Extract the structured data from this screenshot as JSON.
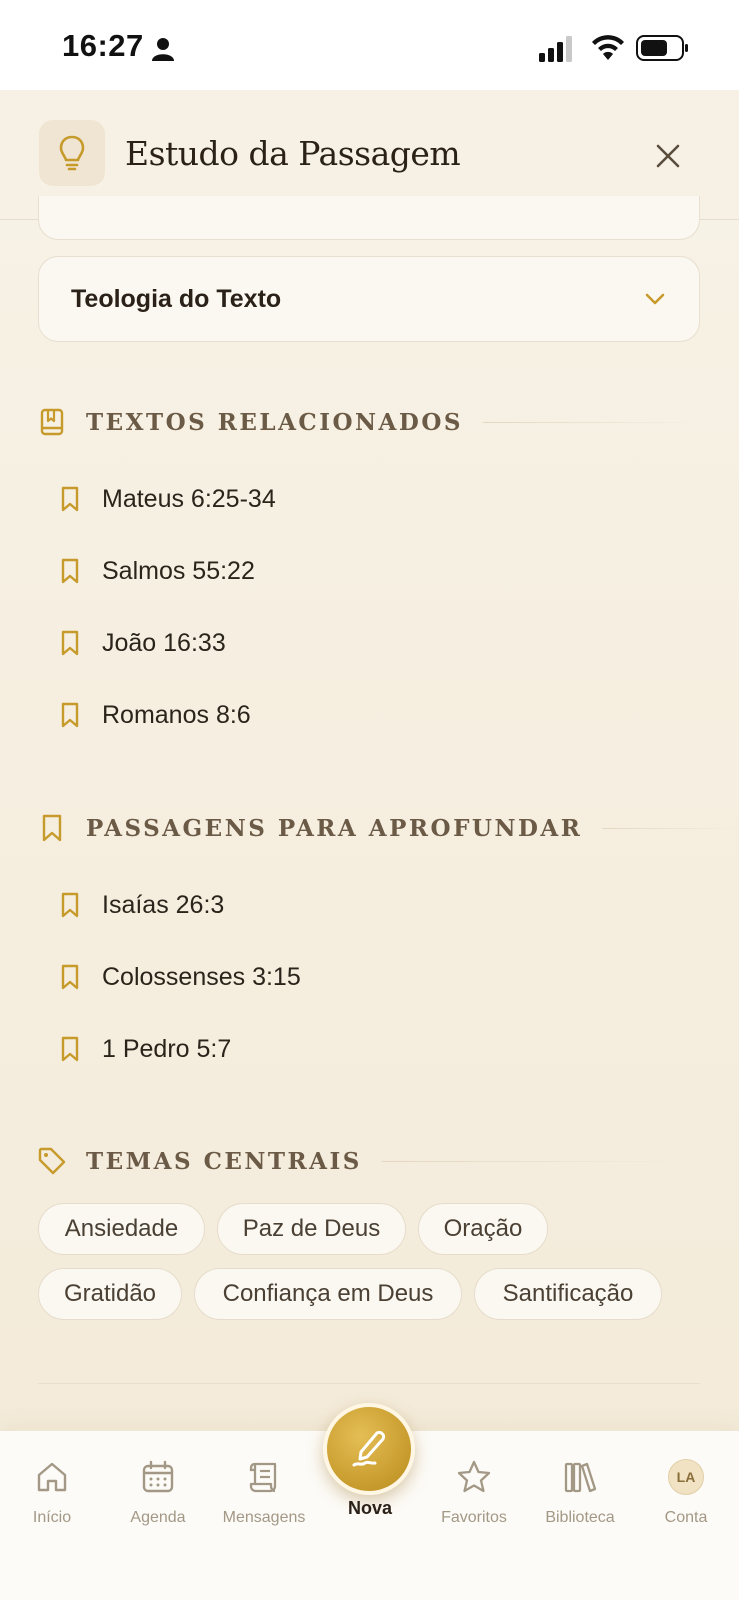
{
  "status_bar": {
    "time": "16:27"
  },
  "header": {
    "title": "Estudo da Passagem",
    "icon": "lightbulb-icon"
  },
  "accordion": {
    "label": "Teologia do Texto"
  },
  "related_texts": {
    "title": "TEXTOS RELACIONADOS",
    "items": [
      "Mateus 6:25-34",
      "Salmos 55:22",
      "João 16:33",
      "Romanos 8:6"
    ]
  },
  "deeper_passages": {
    "title": "PASSAGENS PARA APROFUNDAR",
    "items": [
      "Isaías 26:3",
      "Colossenses 3:15",
      "1 Pedro 5:7"
    ]
  },
  "central_themes": {
    "title": "TEMAS CENTRAIS",
    "tags": [
      "Ansiedade",
      "Paz de Deus",
      "Oração",
      "Gratidão",
      "Confiança em Deus",
      "Santificação"
    ]
  },
  "tabbar": {
    "tabs": [
      {
        "label": "Início",
        "icon": "home-icon"
      },
      {
        "label": "Agenda",
        "icon": "calendar-icon"
      },
      {
        "label": "Mensagens",
        "icon": "scroll-icon"
      },
      {
        "label": "Nova",
        "icon": "pen-icon",
        "active": true
      },
      {
        "label": "Favoritos",
        "icon": "star-icon"
      },
      {
        "label": "Biblioteca",
        "icon": "library-icon"
      },
      {
        "label": "Conta",
        "icon": "avatar",
        "avatar_initials": "LA"
      }
    ]
  },
  "colors": {
    "accent": "#c79a2c",
    "background": "#f6efe1",
    "text": "#2b241b",
    "muted": "#a39886"
  }
}
